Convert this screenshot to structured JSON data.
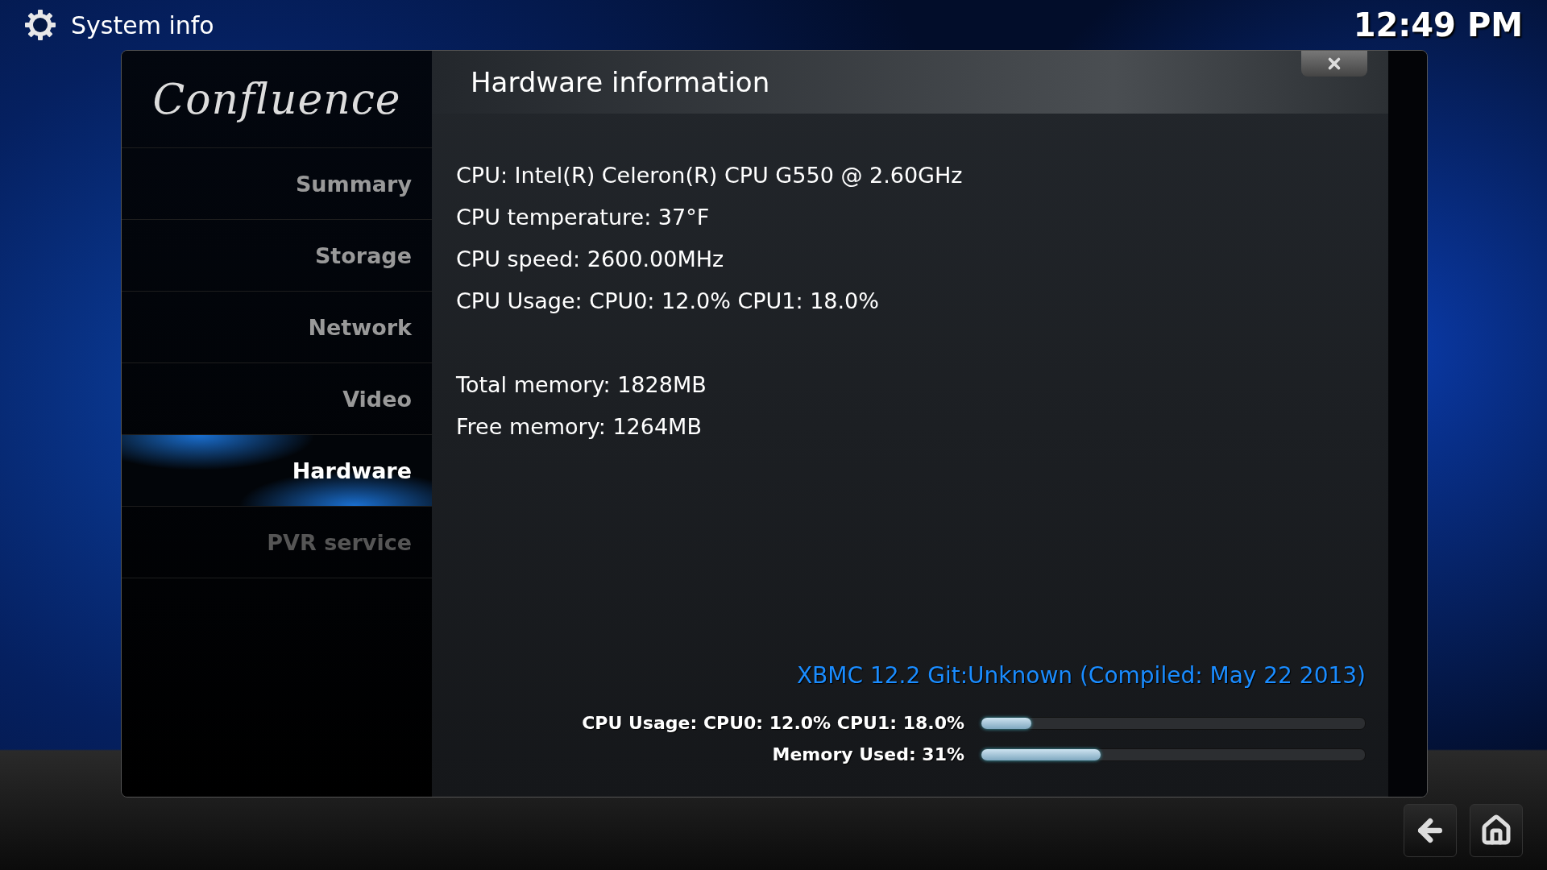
{
  "header": {
    "title": "System info",
    "clock": "12:49 PM"
  },
  "logo": "Confluence",
  "sidebar": {
    "items": [
      {
        "label": "Summary",
        "selected": false,
        "disabled": false
      },
      {
        "label": "Storage",
        "selected": false,
        "disabled": false
      },
      {
        "label": "Network",
        "selected": false,
        "disabled": false
      },
      {
        "label": "Video",
        "selected": false,
        "disabled": false
      },
      {
        "label": "Hardware",
        "selected": true,
        "disabled": false
      },
      {
        "label": "PVR service",
        "selected": false,
        "disabled": true
      }
    ]
  },
  "content": {
    "title": "Hardware information",
    "groups": [
      [
        "CPU: Intel(R) Celeron(R) CPU G550 @ 2.60GHz",
        "CPU temperature: 37°F",
        "CPU speed: 2600.00MHz",
        "CPU Usage: CPU0: 12.0% CPU1: 18.0%"
      ],
      [
        "Total memory: 1828MB",
        "Free memory: 1264MB"
      ]
    ],
    "version": "XBMC 12.2 Git:Unknown (Compiled: May 22 2013)",
    "meters": [
      {
        "label": "CPU Usage: CPU0: 12.0% CPU1: 18.0%",
        "level": 0.13
      },
      {
        "label": "Memory Used: 31%",
        "level": 0.31
      }
    ]
  }
}
